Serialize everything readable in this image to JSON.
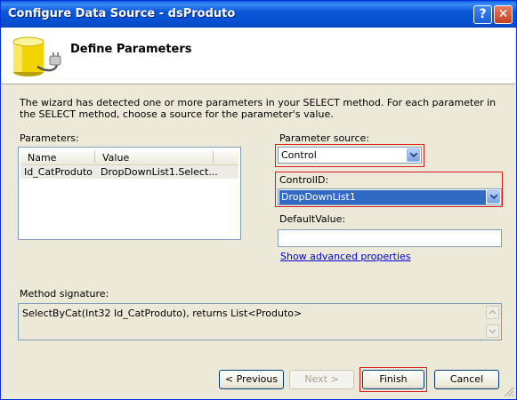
{
  "window": {
    "title": "Configure Data Source - dsProduto",
    "help_glyph": "?",
    "close_glyph": "✕"
  },
  "header": {
    "title": "Define Parameters",
    "icon": "database-plug-icon"
  },
  "description": "The wizard has detected one or more parameters in your SELECT method. For each parameter in the SELECT method, choose a source for the parameter's value.",
  "parameters": {
    "label": "Parameters:",
    "columns": [
      "Name",
      "Value"
    ],
    "rows": [
      {
        "name": "Id_CatProduto",
        "value": "DropDownList1.Select..."
      }
    ]
  },
  "parameter_source": {
    "label": "Parameter source:",
    "selected": "Control"
  },
  "control_id": {
    "label": "ControlID:",
    "selected": "DropDownList1"
  },
  "default_value": {
    "label": "DefaultValue:",
    "value": ""
  },
  "advanced_link": "Show advanced properties",
  "method_signature": {
    "label": "Method signature:",
    "value": "SelectByCat(Int32 Id_CatProduto), returns List<Produto>"
  },
  "buttons": {
    "previous": "< Previous",
    "next": "Next >",
    "finish": "Finish",
    "cancel": "Cancel"
  },
  "colors": {
    "highlight_border": "#d61e1e",
    "selection": "#316ac5",
    "titlebar": "#0a58d8",
    "dialog_bg": "#ece9d8"
  }
}
